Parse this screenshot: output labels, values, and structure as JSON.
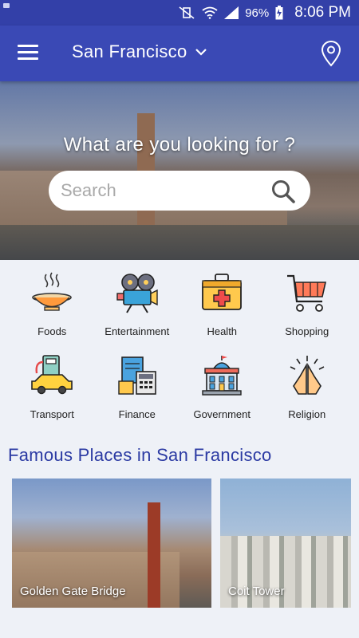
{
  "status_bar": {
    "battery": "96%",
    "time": "8:06 PM"
  },
  "app_bar": {
    "city": "San Francisco"
  },
  "hero": {
    "title": "What are you looking for ?",
    "search_placeholder": "Search"
  },
  "categories": [
    {
      "label": "Foods",
      "icon": "food-bowl-icon"
    },
    {
      "label": "Entertainment",
      "icon": "film-camera-icon"
    },
    {
      "label": "Health",
      "icon": "first-aid-kit-icon"
    },
    {
      "label": "Shopping",
      "icon": "shopping-cart-icon"
    },
    {
      "label": "Transport",
      "icon": "taxi-fuel-icon"
    },
    {
      "label": "Finance",
      "icon": "finance-calculator-icon"
    },
    {
      "label": "Government",
      "icon": "government-building-icon"
    },
    {
      "label": "Religion",
      "icon": "praying-hands-icon"
    }
  ],
  "famous": {
    "title": "Famous Places in San Francisco",
    "places": [
      {
        "name": "Golden Gate Bridge"
      },
      {
        "name": "Coit Tower"
      }
    ]
  },
  "colors": {
    "primary": "#3a49b5",
    "status_bar": "#3340a8",
    "section_title": "#2b3aa3",
    "background": "#eef1f7"
  }
}
